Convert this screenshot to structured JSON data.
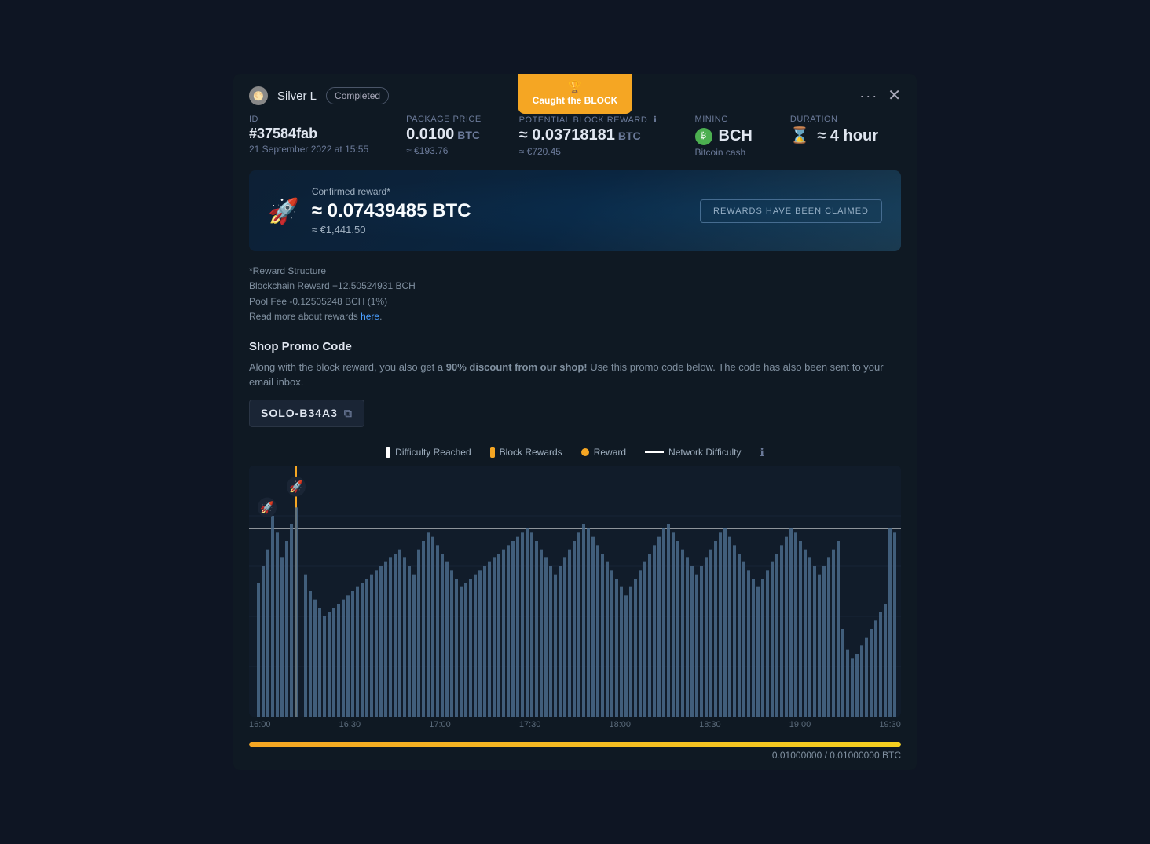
{
  "modal": {
    "badge": {
      "icon": "🏆",
      "text": "Caught the BLOCK"
    },
    "header": {
      "user_name": "Silver L",
      "status": "Completed"
    },
    "id_section": {
      "label": "ID",
      "value": "#37584fab",
      "date": "21 September 2022 at 15:55"
    },
    "package_price": {
      "label": "Package Price",
      "value": "0.0100",
      "currency": "BTC",
      "eur": "≈ €193.76"
    },
    "potential_reward": {
      "label": "Potential Block Reward",
      "value": "≈ 0.03718181",
      "currency": "BTC",
      "eur": "≈ €720.45"
    },
    "mining": {
      "label": "Mining",
      "coin": "BCH",
      "coin_name": "Bitcoin cash"
    },
    "duration": {
      "label": "Duration",
      "value": "≈ 4 hour"
    },
    "reward_banner": {
      "confirmed_label": "Confirmed reward*",
      "amount": "≈ 0.07439485 BTC",
      "eur": "≈ €1,441.50",
      "claim_btn": "REWARDS HAVE BEEN CLAIMED"
    },
    "reward_structure": {
      "title": "*Reward Structure",
      "blockchain": "Blockchain Reward +12.50524931 BCH",
      "pool_fee": "Pool Fee -0.12505248 BCH (1%)",
      "read_more_prefix": "Read more about rewards ",
      "read_more_link": "here",
      "read_more_suffix": "."
    },
    "promo": {
      "title": "Shop Promo Code",
      "description": "Along with the block reward, you also get a 90% discount from our shop! Use this promo code below. The code has also been sent to your email inbox.",
      "code": "SOLO-B34A3",
      "bold_text": "90% discount from our shop!"
    },
    "legend": {
      "difficulty_reached": "Difficulty Reached",
      "block_rewards": "Block Rewards",
      "reward": "Reward",
      "network_difficulty": "Network Difficulty"
    },
    "chart": {
      "x_labels": [
        "16:00",
        "16:30",
        "17:00",
        "17:30",
        "18:00",
        "18:30",
        "19:00",
        "19:30"
      ]
    },
    "progress": {
      "value": "0.01000000 / 0.01000000 BTC"
    }
  }
}
